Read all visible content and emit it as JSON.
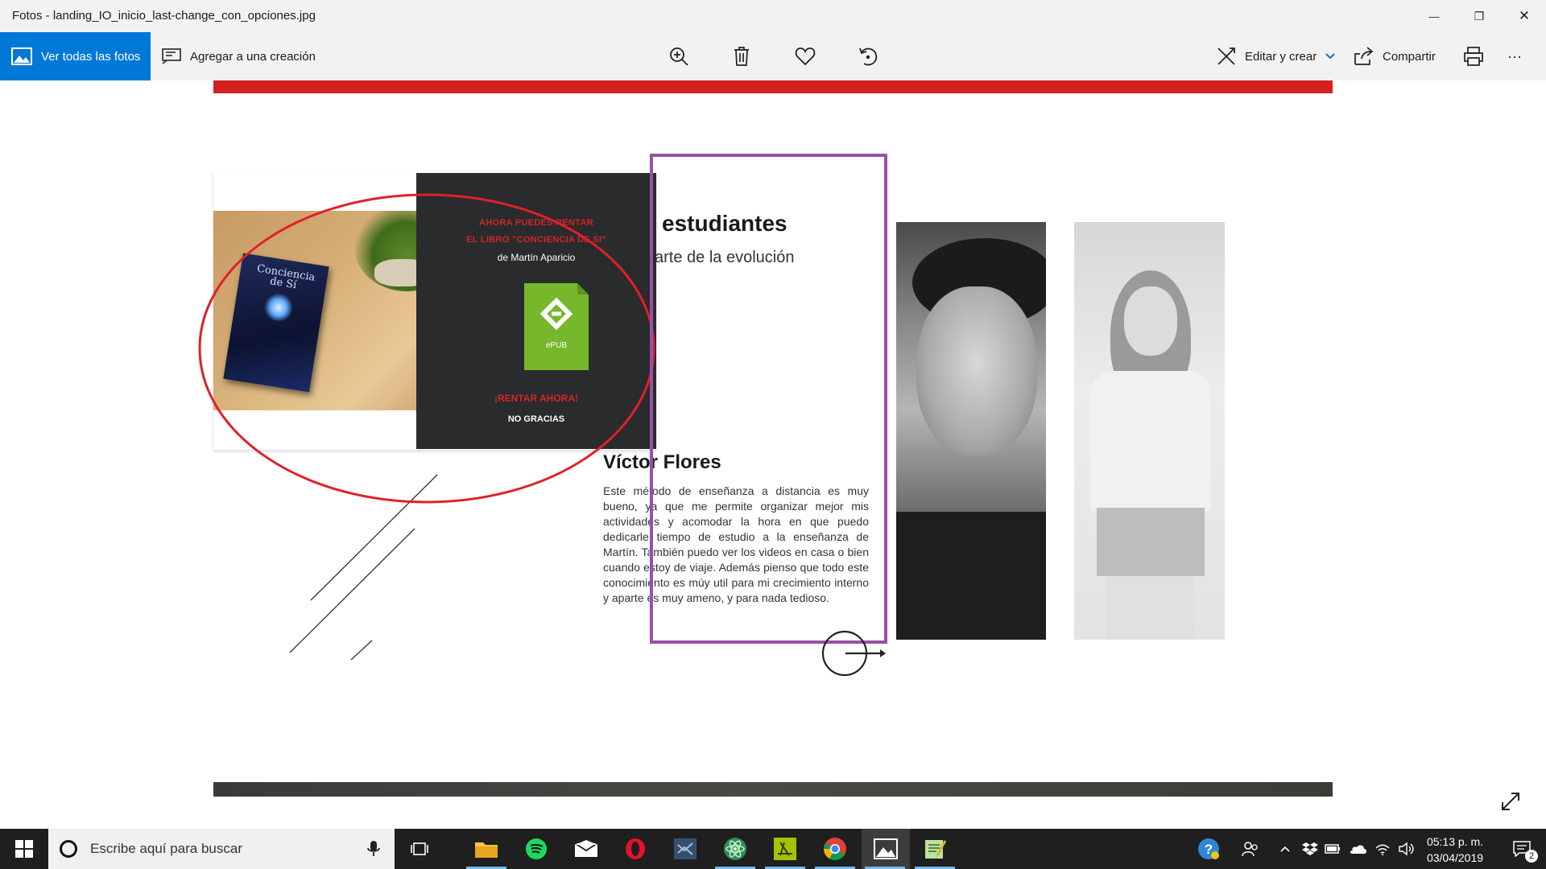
{
  "window": {
    "title": "Fotos - landing_IO_inicio_last-change_con_opciones.jpg",
    "min_glyph": "—",
    "restore_glyph": "❐",
    "close_glyph": "✕"
  },
  "toolbar": {
    "see_all_label": "Ver todas las fotos",
    "add_to_creation_label": "Agregar a una creación",
    "edit_create_label": "Editar y crear",
    "share_label": "Compartir",
    "more_glyph": "···",
    "icons": [
      "zoom-in-icon",
      "trash-icon",
      "heart-icon",
      "rotate-icon",
      "edit-create-icon",
      "share-icon",
      "print-icon",
      "more-icon"
    ]
  },
  "image": {
    "popup": {
      "line1": "AHORA PUEDES RENTAR",
      "line2": "EL LIBRO \"CONCIENCIA DE SI\"",
      "author": "de Martín Aparicio",
      "epub_label": "ePUB",
      "rent_cta": "¡RENTAR AHORA!",
      "no_thanks": "NO GRACIAS"
    },
    "book_title": "Conciencia de Sí",
    "heading": "estudiantes",
    "subheading": "arte de la evolución",
    "testimonial_name": "Víctor Flores",
    "testimonial_text": "Este método de enseñanza a distancia es muy bueno, ya que me permite organizar mejor mis actividades y acomodar la hora en que puedo dedicarle tiempo de estudio a la enseñanza de Martín. También puedo ver los videos en casa o bien cuando estoy de viaje. Además pienso que todo este conocimiento es múy util para mi crecimiento interno y aparte es muy ameno, y para nada tedioso.",
    "colors": {
      "red_bar": "#d42020",
      "annotation_red": "#e0202a",
      "annotation_purple": "#9b4ea8",
      "epub_green": "#77b72b"
    }
  },
  "taskbar": {
    "search_placeholder": "Escribe aquí para buscar",
    "apps": [
      "task-view-icon",
      "file-explorer-icon",
      "spotify-icon",
      "mail-icon",
      "opera-icon",
      "visual-studio-icon",
      "atom-icon",
      "filezilla-icon",
      "chrome-icon",
      "photos-icon",
      "notepad-icon"
    ],
    "time": "05:13 p. m.",
    "date": "03/04/2019",
    "notification_count": "2",
    "tray_icons": [
      "help-icon",
      "people-icon",
      "chevron-up-icon",
      "dropbox-icon",
      "battery-icon",
      "onedrive-icon",
      "wifi-icon",
      "volume-icon",
      "action-center-icon"
    ]
  }
}
